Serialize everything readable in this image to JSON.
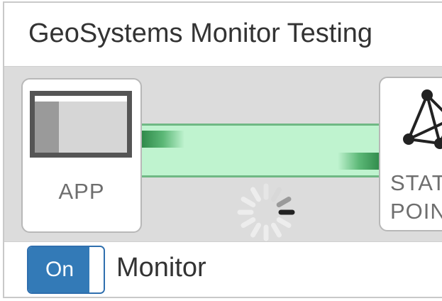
{
  "window": {
    "title": "GeoSystems Monitor Testing"
  },
  "diagram": {
    "nodes": [
      {
        "label": "APP",
        "icon": "application-window-icon"
      },
      {
        "label_lines": [
          "STAT",
          "POIN"
        ],
        "icon": "network-graph-icon"
      }
    ],
    "connection": {
      "color": "#bff3cf",
      "border_color": "#6fb884",
      "pulse_color": "#2f8a4a"
    },
    "loading_spinner": "loading-spinner-icon"
  },
  "footer": {
    "toggle_state": "On",
    "toggle_color": "#337ab7",
    "label": "Monitor"
  }
}
